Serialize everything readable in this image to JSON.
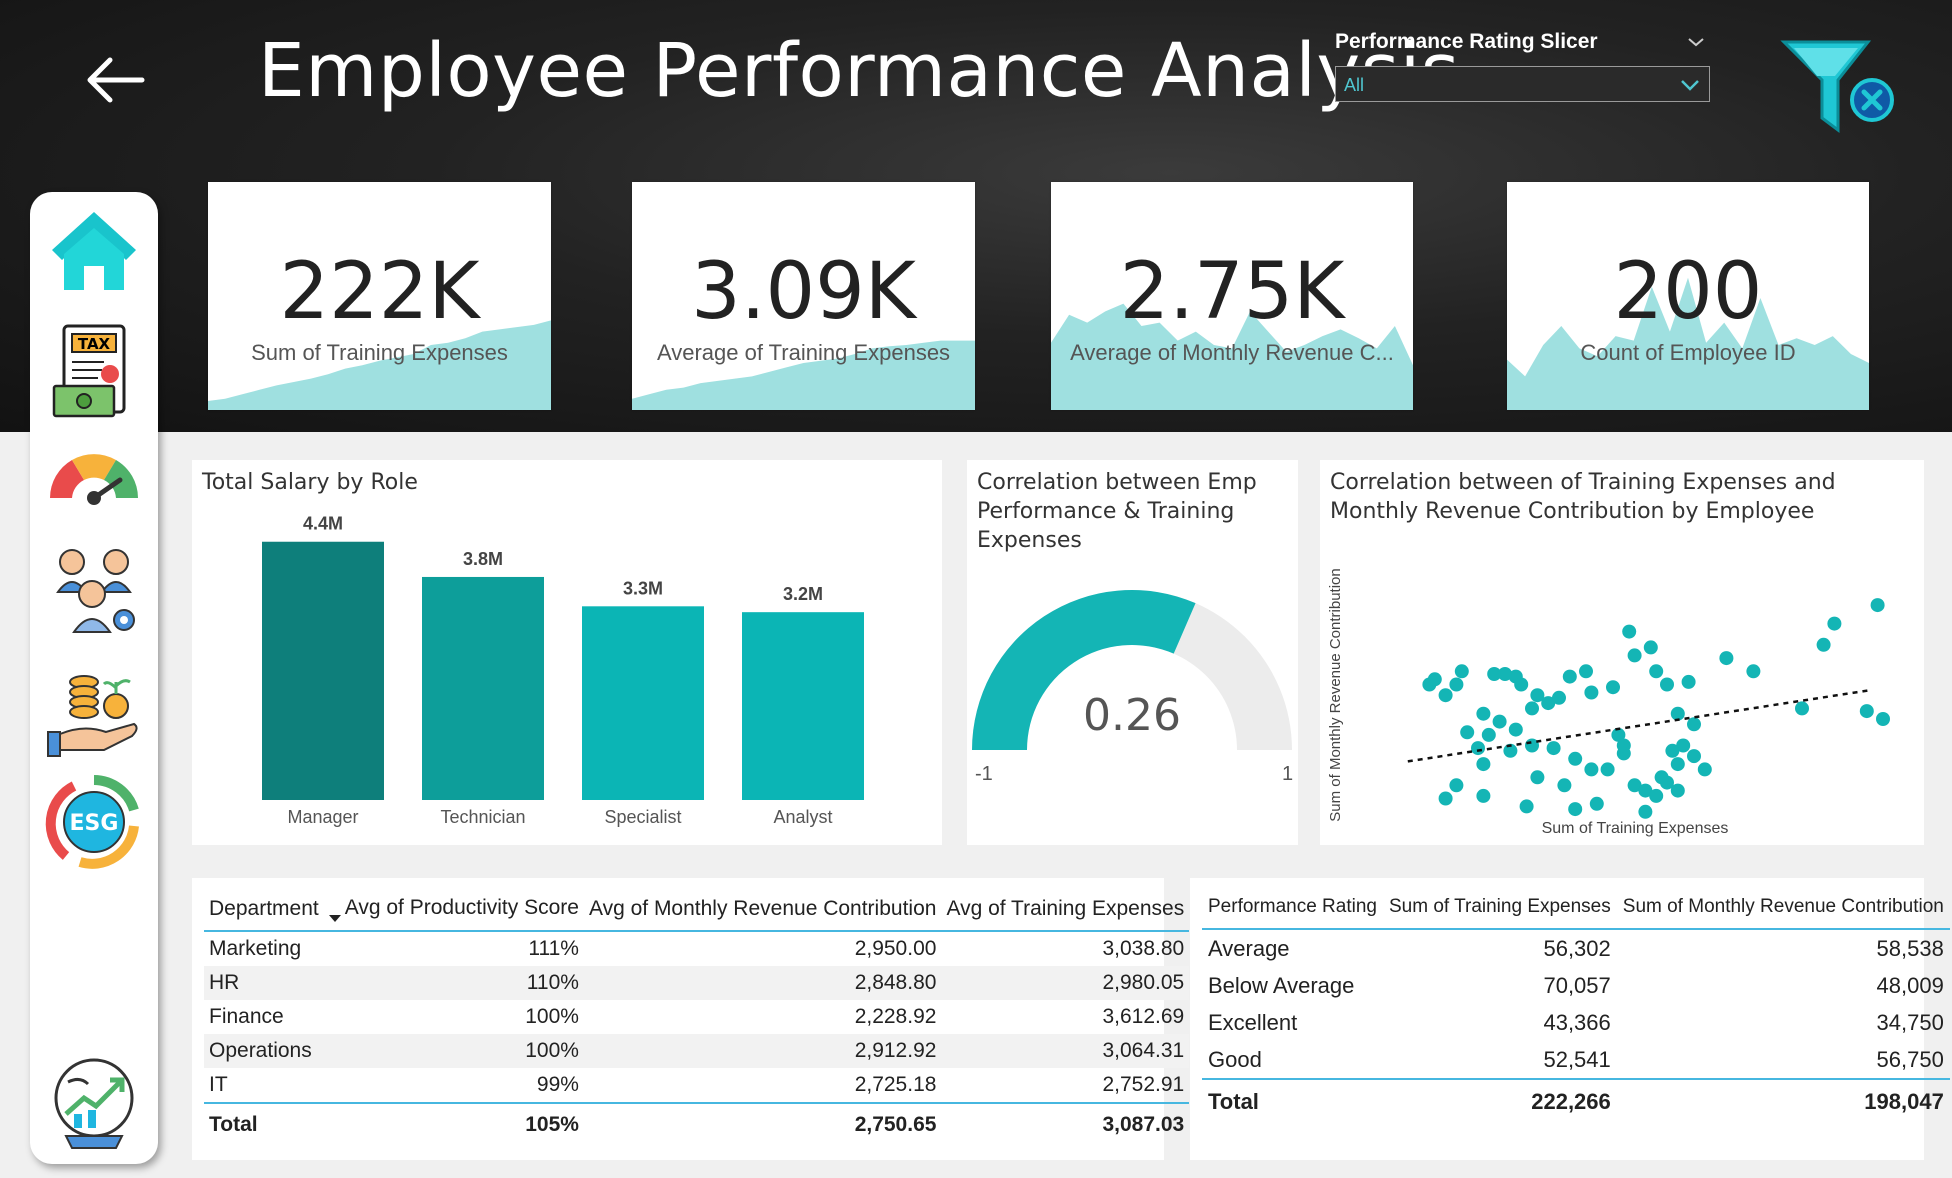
{
  "header": {
    "title": "Employee Performance Analysis",
    "slicer_title": "Performance Rating Slicer",
    "slicer_value": "All"
  },
  "sidebar": {
    "items": [
      {
        "icon": "home-icon"
      },
      {
        "icon": "tax-icon"
      },
      {
        "icon": "gauge-icon"
      },
      {
        "icon": "team-icon"
      },
      {
        "icon": "money-hand-icon"
      },
      {
        "icon": "esg-icon"
      },
      {
        "icon": "growth-globe-icon"
      }
    ]
  },
  "kpis": [
    {
      "value": "222K",
      "label": "Sum of Training Expenses"
    },
    {
      "value": "3.09K",
      "label": "Average of Training Expenses"
    },
    {
      "value": "2.75K",
      "label": "Average of Monthly Revenue C..."
    },
    {
      "value": "200",
      "label": "Count of Employee ID"
    }
  ],
  "colors": {
    "teal_dark": "#0e7f7b",
    "teal_mid": "#0d9e9a",
    "teal": "#0bb5b5",
    "spark": "#9fe0e0",
    "header_line": "#46b7e0"
  },
  "bar_panel": {
    "title": "Total Salary by Role"
  },
  "gauge_panel": {
    "title_lines": [
      "Correlation between Emp",
      "Performance & Training",
      "Expenses"
    ],
    "value": "0.26",
    "min_label": "-1",
    "max_label": "1"
  },
  "scatter_panel": {
    "title_lines": [
      "Correlation between of Training Expenses and",
      "Monthly Revenue Contribution by Employee"
    ],
    "xlabel": "Sum of Training Expenses",
    "ylabel": "Sum of Monthly Revenue Contribution"
  },
  "chart_data": [
    {
      "type": "bar",
      "title": "Total Salary by Role",
      "categories": [
        "Manager",
        "Technician",
        "Specialist",
        "Analyst"
      ],
      "values": [
        4.4,
        3.8,
        3.3,
        3.2
      ],
      "data_labels": [
        "4.4M",
        "3.8M",
        "3.3M",
        "3.2M"
      ],
      "ylim": [
        0,
        4.6
      ],
      "colors": [
        "#0e7f7b",
        "#0d9e9a",
        "#0bb5b5",
        "#0bb5b5"
      ]
    },
    {
      "type": "gauge",
      "value": 0.26,
      "min": -1,
      "max": 1
    },
    {
      "type": "scatter",
      "xlabel": "Sum of Training Expenses",
      "ylabel": "Sum of Monthly Revenue Contribution",
      "xlim": [
        0,
        100
      ],
      "ylim": [
        0,
        100
      ],
      "trendline": [
        [
          7,
          24
        ],
        [
          93,
          51
        ]
      ],
      "points": [
        [
          14,
          49
        ],
        [
          11,
          53
        ],
        [
          16,
          53
        ],
        [
          12,
          55
        ],
        [
          17,
          58
        ],
        [
          23,
          57
        ],
        [
          25,
          57
        ],
        [
          27,
          56
        ],
        [
          28,
          53
        ],
        [
          31,
          49
        ],
        [
          33,
          46
        ],
        [
          35,
          48
        ],
        [
          37,
          56
        ],
        [
          30,
          44
        ],
        [
          40,
          58
        ],
        [
          41,
          50
        ],
        [
          45,
          52
        ],
        [
          49,
          64
        ],
        [
          48,
          73
        ],
        [
          52,
          67
        ],
        [
          53,
          58
        ],
        [
          55,
          53
        ],
        [
          57,
          42
        ],
        [
          60,
          38
        ],
        [
          59,
          54
        ],
        [
          18,
          35
        ],
        [
          20,
          29
        ],
        [
          21,
          23
        ],
        [
          22,
          34
        ],
        [
          24,
          39
        ],
        [
          26,
          28
        ],
        [
          27,
          36
        ],
        [
          30,
          30
        ],
        [
          31,
          18
        ],
        [
          34,
          29
        ],
        [
          36,
          15
        ],
        [
          38,
          25
        ],
        [
          41,
          21
        ],
        [
          44,
          21
        ],
        [
          46,
          34
        ],
        [
          47,
          27
        ],
        [
          49,
          15
        ],
        [
          51,
          13
        ],
        [
          53,
          11
        ],
        [
          55,
          16
        ],
        [
          57,
          23
        ],
        [
          58,
          30
        ],
        [
          54,
          18
        ],
        [
          56,
          28
        ],
        [
          60,
          26
        ],
        [
          62,
          21
        ],
        [
          14,
          10
        ],
        [
          16,
          15
        ],
        [
          21,
          11
        ],
        [
          29,
          7
        ],
        [
          38,
          6
        ],
        [
          42,
          8
        ],
        [
          51,
          5
        ],
        [
          71,
          58
        ],
        [
          80,
          44
        ],
        [
          92,
          43
        ],
        [
          84,
          68
        ],
        [
          86,
          76
        ],
        [
          94,
          83
        ],
        [
          95,
          40
        ],
        [
          21,
          42
        ],
        [
          47,
          30
        ],
        [
          57,
          13
        ],
        [
          66,
          63
        ]
      ]
    },
    {
      "type": "area",
      "name": "kpi1-spark",
      "values": [
        8,
        10,
        14,
        18,
        22,
        25,
        28,
        32,
        37,
        40,
        44,
        47,
        50,
        58,
        60,
        64,
        70,
        72,
        74,
        76,
        80
      ]
    },
    {
      "type": "area",
      "name": "kpi2-spark",
      "values": [
        10,
        14,
        18,
        20,
        24,
        26,
        28,
        30,
        34,
        38,
        42,
        44,
        46,
        50,
        55,
        57,
        58,
        60,
        62,
        62,
        62
      ]
    },
    {
      "type": "area",
      "name": "kpi3-spark",
      "values": [
        60,
        85,
        78,
        88,
        95,
        75,
        78,
        62,
        70,
        58,
        55,
        88,
        70,
        52,
        58,
        66,
        72,
        64,
        55,
        75,
        40
      ]
    },
    {
      "type": "area",
      "name": "kpi4-spark",
      "values": [
        45,
        30,
        58,
        75,
        55,
        48,
        66,
        62,
        110,
        70,
        118,
        60,
        78,
        55,
        100,
        58,
        64,
        58,
        66,
        50,
        42
      ]
    }
  ],
  "dept_table": {
    "headers": [
      "Department",
      "Avg of Productivity Score",
      "Avg of Monthly Revenue Contribution",
      "Avg of Training Expenses"
    ],
    "rows": [
      [
        "Marketing",
        "111%",
        "2,950.00",
        "3,038.80"
      ],
      [
        "HR",
        "110%",
        "2,848.80",
        "2,980.05"
      ],
      [
        "Finance",
        "100%",
        "2,228.92",
        "3,612.69"
      ],
      [
        "Operations",
        "100%",
        "2,912.92",
        "3,064.31"
      ],
      [
        "IT",
        "99%",
        "2,725.18",
        "2,752.91"
      ]
    ],
    "total": [
      "Total",
      "105%",
      "2,750.65",
      "3,087.03"
    ]
  },
  "rating_table": {
    "headers": [
      "Performance Rating",
      "Sum of Training Expenses",
      "Sum of Monthly Revenue Contribution"
    ],
    "rows": [
      [
        "Average",
        "56,302",
        "58,538"
      ],
      [
        "Below Average",
        "70,057",
        "48,009"
      ],
      [
        "Excellent",
        "43,366",
        "34,750"
      ],
      [
        "Good",
        "52,541",
        "56,750"
      ]
    ],
    "total": [
      "Total",
      "222,266",
      "198,047"
    ]
  }
}
